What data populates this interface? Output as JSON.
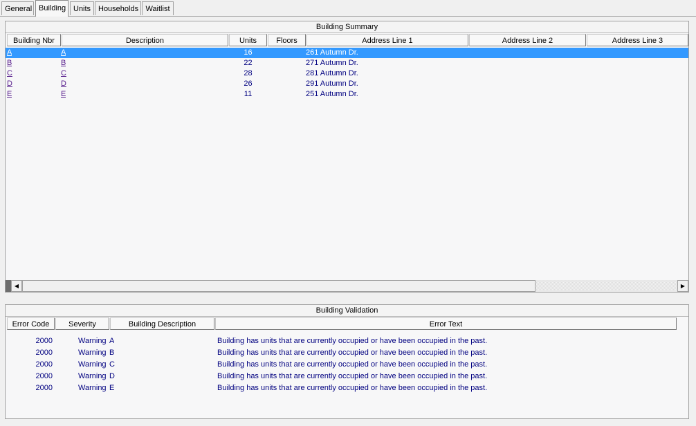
{
  "tabs": [
    "General",
    "Building",
    "Units",
    "Households",
    "Waitlist"
  ],
  "active_tab": 1,
  "building_summary": {
    "title": "Building Summary",
    "columns": [
      "Building Nbr",
      "Description",
      "Units",
      "Floors",
      "Address Line 1",
      "Address Line 2",
      "Address Line 3"
    ],
    "rows": [
      {
        "nbr": "A",
        "desc": "A",
        "units": "16",
        "floors": "",
        "addr1": "261 Autumn Dr.",
        "addr2": "",
        "addr3": ""
      },
      {
        "nbr": "B",
        "desc": "B",
        "units": "22",
        "floors": "",
        "addr1": "271 Autumn Dr.",
        "addr2": "",
        "addr3": ""
      },
      {
        "nbr": "C",
        "desc": "C",
        "units": "28",
        "floors": "",
        "addr1": "281 Autumn Dr.",
        "addr2": "",
        "addr3": ""
      },
      {
        "nbr": "D",
        "desc": "D",
        "units": "26",
        "floors": "",
        "addr1": "291 Autumn Dr.",
        "addr2": "",
        "addr3": ""
      },
      {
        "nbr": "E",
        "desc": "E",
        "units": "11",
        "floors": "",
        "addr1": "251 Autumn Dr.",
        "addr2": "",
        "addr3": ""
      }
    ],
    "selected_row": 0
  },
  "building_validation": {
    "title": "Building Validation",
    "columns": [
      "Error Code",
      "Severity",
      "Building Description",
      "Error Text"
    ],
    "rows": [
      {
        "code": "2000",
        "severity": "Warning",
        "building": "A",
        "text": "Building has units that are currently occupied or have been occupied in the past."
      },
      {
        "code": "2000",
        "severity": "Warning",
        "building": "B",
        "text": "Building has units that are currently occupied or have been occupied in the past."
      },
      {
        "code": "2000",
        "severity": "Warning",
        "building": "C",
        "text": "Building has units that are currently occupied or have been occupied in the past."
      },
      {
        "code": "2000",
        "severity": "Warning",
        "building": "D",
        "text": "Building has units that are currently occupied or have been occupied in the past."
      },
      {
        "code": "2000",
        "severity": "Warning",
        "building": "E",
        "text": "Building has units that are currently occupied or have been occupied in the past."
      }
    ]
  },
  "scrollbar": {
    "left_arrow": "◀",
    "right_arrow": "▶"
  },
  "colors": {
    "selection": "#3399ff",
    "link": "#551a8b",
    "text_navy": "#000080"
  }
}
